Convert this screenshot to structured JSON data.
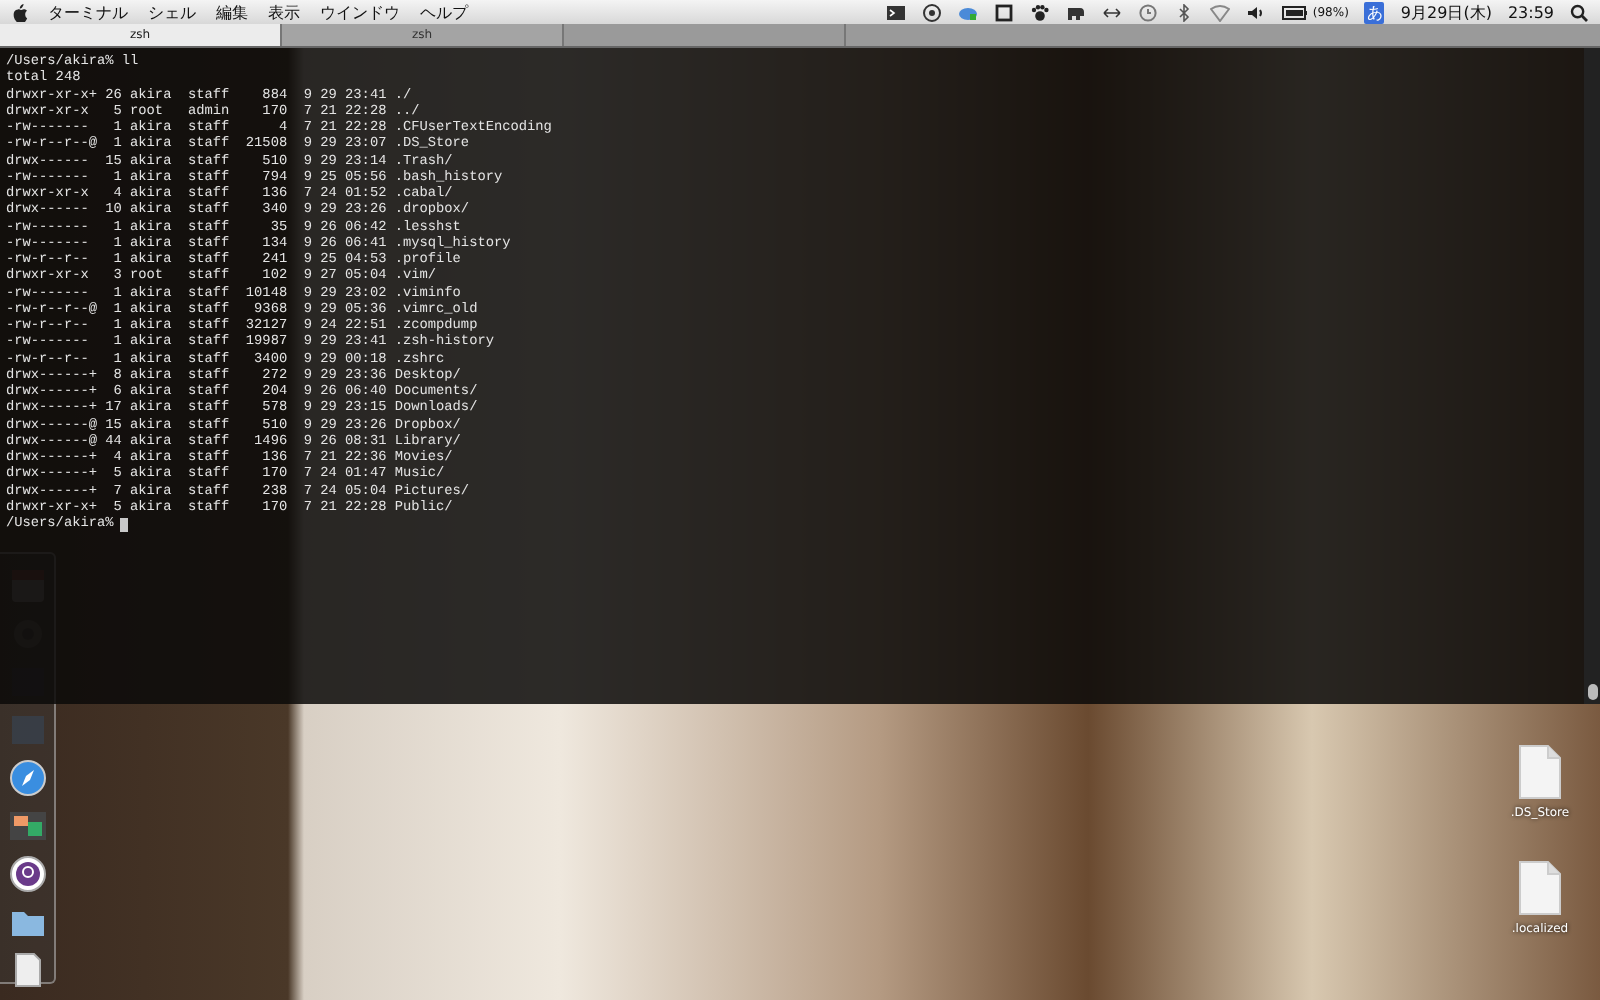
{
  "menu_bar": {
    "menus": [
      "ターミナル",
      "シェル",
      "編集",
      "表示",
      "ウインドウ",
      "ヘルプ"
    ],
    "battery": "(98%)",
    "input_method": "あ",
    "date": "9月29日(木)",
    "time": "23:59"
  },
  "tabs": [
    {
      "label": "zsh",
      "selected": true
    },
    {
      "label": "zsh",
      "selected": false
    }
  ],
  "terminal": {
    "lines": [
      "/Users/akira% ll",
      "total 248",
      "drwxr-xr-x+ 26 akira  staff    884  9 29 23:41 ./",
      "drwxr-xr-x   5 root   admin    170  7 21 22:28 ../",
      "-rw-------   1 akira  staff      4  7 21 22:28 .CFUserTextEncoding",
      "-rw-r--r--@  1 akira  staff  21508  9 29 23:07 .DS_Store",
      "drwx------  15 akira  staff    510  9 29 23:14 .Trash/",
      "-rw-------   1 akira  staff    794  9 25 05:56 .bash_history",
      "drwxr-xr-x   4 akira  staff    136  7 24 01:52 .cabal/",
      "drwx------  10 akira  staff    340  9 29 23:26 .dropbox/",
      "-rw-------   1 akira  staff     35  9 26 06:42 .lesshst",
      "-rw-------   1 akira  staff    134  9 26 06:41 .mysql_history",
      "-rw-r--r--   1 akira  staff    241  9 25 04:53 .profile",
      "drwxr-xr-x   3 root   staff    102  9 27 05:04 .vim/",
      "-rw-------   1 akira  staff  10148  9 29 23:02 .viminfo",
      "-rw-r--r--@  1 akira  staff   9368  9 29 05:36 .vimrc_old",
      "-rw-r--r--   1 akira  staff  32127  9 24 22:51 .zcompdump",
      "-rw-------   1 akira  staff  19987  9 29 23:41 .zsh-history",
      "-rw-r--r--   1 akira  staff   3400  9 29 00:18 .zshrc",
      "drwx------+  8 akira  staff    272  9 29 23:36 Desktop/",
      "drwx------+  6 akira  staff    204  9 26 06:40 Documents/",
      "drwx------+ 17 akira  staff    578  9 29 23:15 Downloads/",
      "drwx------@ 15 akira  staff    510  9 29 23:26 Dropbox/",
      "drwx------@ 44 akira  staff   1496  9 26 08:31 Library/",
      "drwx------+  4 akira  staff    136  7 21 22:36 Movies/",
      "drwx------+  5 akira  staff    170  7 24 01:47 Music/",
      "drwx------+  7 akira  staff    238  7 24 05:04 Pictures/",
      "drwxr-xr-x+  5 akira  staff    170  7 21 22:28 Public/"
    ],
    "prompt": "/Users/akira%"
  },
  "desktop_icons": [
    {
      "label": ".DS_Store"
    },
    {
      "label": ".localized"
    }
  ]
}
